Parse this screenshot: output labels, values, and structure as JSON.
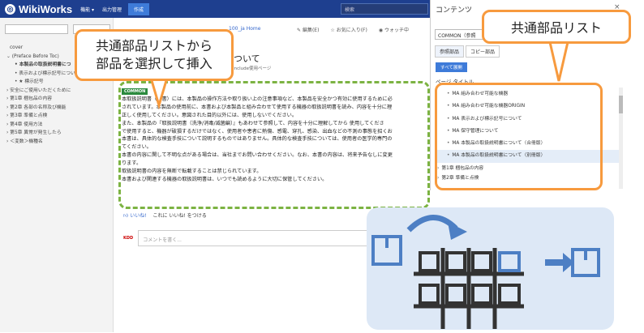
{
  "topbar": {
    "logo": "WikiWorks",
    "nav_features": "機能 ▾",
    "nav_output": "出力管理",
    "nav_create": "作成",
    "search_placeholder": "検索"
  },
  "sidebar": {
    "items": [
      "cover",
      "(Preface Before Toc)",
      "本製品の取扱説明書につ",
      "表示および標示記号につい",
      "★ 標示記号",
      "安全にご使用いただくために",
      "第1章 梱包品の内容",
      "第2章 各部の名称及び機能",
      "第3章 準備と点検",
      "第4章 使用方法",
      "第5章 異常が発生したら",
      "＜変数＞機種名"
    ]
  },
  "main": {
    "breadcrumb": "100_ja Home",
    "action_edit": "編集(E)",
    "action_favorite": "お気に入り(F)",
    "action_watch": "ウォッチ中",
    "title": "ついて",
    "include_label": "Include使用ページ",
    "common_tag": "COMMON",
    "paragraphs": [
      "本取扱説明書（本書）には、本製品の操作方法や取り扱い上の注意事項など、本製品を安全かつ有効に使用するために必",
      "されています。本製品の使用前に、本書および本製品と組み合わせて使用する機器の取扱説明書を読み、内容を十分に理",
      "正しく使用してください。意図された目的以外には、使用しないでください。",
      "また、本製品の『取扱説明書（洗浄/消毒/滅菌編）』もあわせて参照して、内容を十分に理解してから 使用してくださ",
      "で使用すると、機器が破損するだけではなく、使用者や患者に熱傷、感電、穿孔、感染、出血などの不測の事態を招くお",
      "本書は、具体的な検査手技について説明するものではありません。具体的な検査手技については、使用者の医学的専門の",
      "てください。",
      "本書の内容に関して不明な点がある場合は、当社までお問い合わせください。なお、本書の内容は、将来予告なしに変更",
      "ります。",
      "取扱説明書の内容を無断で転載することは禁じられています。",
      "本書および関連する機器の取扱説明書は、いつでも読めるように大切に保管してください。"
    ],
    "like_label": "いいね!",
    "like_text": "これに いいね! をつける",
    "comment_avatar": "KDD",
    "comment_placeholder": "コメントを書く..."
  },
  "panel": {
    "title": "コンテンツ",
    "search_value": "COMMON（参照",
    "tab_reference": "参照部品",
    "tab_copy": "コピー部品",
    "expand_all": "すべて展開",
    "page_title_label": "ページ タイトル",
    "parts": [
      "MA  組み合わせ可能な機器",
      "MA  組み合わせ可能な機器ORIGIN",
      "MA  表示および標示記号について",
      "MA  保守管理について",
      "MA  本製品の取扱説明書について（合冊版）",
      "MA  本製品の取扱説明書について（別冊版）"
    ],
    "chapter1": "第1章 梱包品の内容",
    "chapter2": "第2章 準備と点検"
  },
  "callouts": {
    "select_insert": [
      "共通部品リストから",
      "部品を選択して挿入"
    ],
    "common_list": "共通部品リスト"
  },
  "colors": {
    "topbar": "#1e3f8f",
    "accent_orange": "#f79a3e",
    "dash_green": "#7cb342",
    "illustration_bg": "#dde8f6"
  }
}
